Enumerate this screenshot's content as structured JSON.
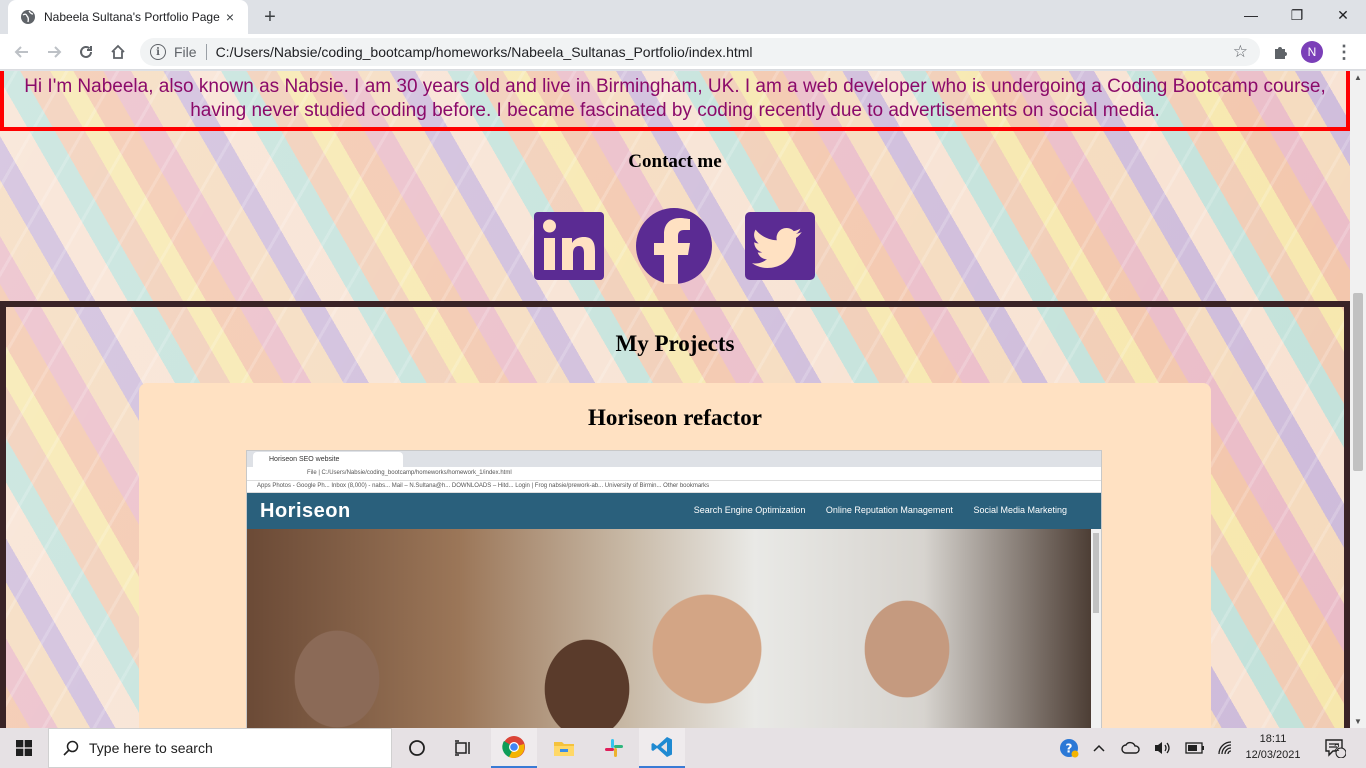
{
  "browser": {
    "tab_title": "Nabeela Sultana's Portfolio Page",
    "tab_close": "×",
    "new_tab": "+",
    "address_label": "File",
    "url": "C:/Users/Nabsie/coding_bootcamp/homeworks/Nabeela_Sultanas_Portfolio/index.html",
    "avatar_letter": "N",
    "window": {
      "minimize": "—",
      "restore": "❐",
      "close": "✕"
    }
  },
  "page": {
    "about_text": "Hi I'm Nabeela, also known as Nabsie. I am 30 years old and live in Birmingham, UK. I am a web developer who is undergoing a Coding Bootcamp course, having never studied coding before. I became fascinated by coding recently due to advertisements on social media.",
    "contact_heading": "Contact me",
    "social_links": [
      {
        "icon": "linkedin-icon",
        "color": "#5b2b93"
      },
      {
        "icon": "facebook-icon",
        "color": "#5b2b93"
      },
      {
        "icon": "twitter-icon",
        "color": "#5b2b93"
      }
    ],
    "projects_heading": "My Projects",
    "projects": [
      {
        "title": "Horiseon refactor",
        "screenshot": {
          "tab": "Horiseon SEO website",
          "address": "File  |  C:/Users/Nabsie/coding_bootcamp/homeworks/homework_1/index.html",
          "bookmarks": "Apps    Photos - Google Ph...    Inbox (8,000) - nabs...    Mail – N.Sultana@h...    DOWNLOADS – Hitd...    Login | Frog    nabsie/prework-ab...    University of Birmin...    Other bookmarks",
          "logo": "Horiseon",
          "nav": [
            "Search Engine Optimization",
            "Online Reputation Management",
            "Social Media Marketing"
          ]
        }
      }
    ]
  },
  "taskbar": {
    "search_placeholder": "Type here to search",
    "time": "18:11",
    "date": "12/03/2021",
    "notification_count": "2"
  },
  "colors": {
    "about_border": "#ff0000",
    "about_text": "#8b0a6a",
    "projects_border": "#3a2326",
    "card_bg": "#ffe1c2",
    "social_purple": "#5b2b93"
  }
}
